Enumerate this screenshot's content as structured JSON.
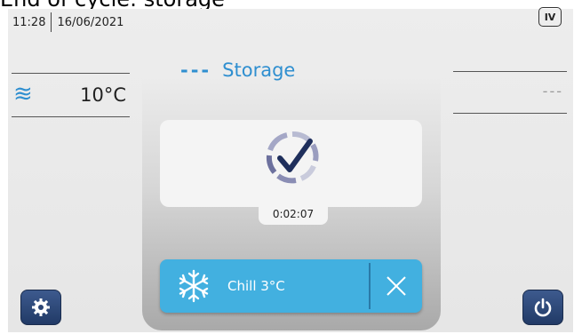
{
  "caption": "End of cycle: storage",
  "status_bar": {
    "time": "11:28",
    "date": "16/06/2021",
    "level_badge": "IV"
  },
  "left_panel": {
    "icon": "ventilation-wave-icon",
    "temperature": "10°C"
  },
  "right_panel": {
    "value": "---"
  },
  "cycle": {
    "dashes": "---",
    "title": "Storage",
    "status_icon": "check-complete-icon",
    "timer": "0:02:07"
  },
  "program": {
    "icon": "snowflake-icon",
    "label": "Chill 3°C",
    "cancel_icon": "close-icon"
  },
  "buttons": {
    "settings_icon": "gear-icon",
    "power_icon": "power-icon"
  },
  "colors": {
    "accent": "#42b0e0",
    "title_blue": "#2f8fd0",
    "button_navy": "#2b4473"
  }
}
